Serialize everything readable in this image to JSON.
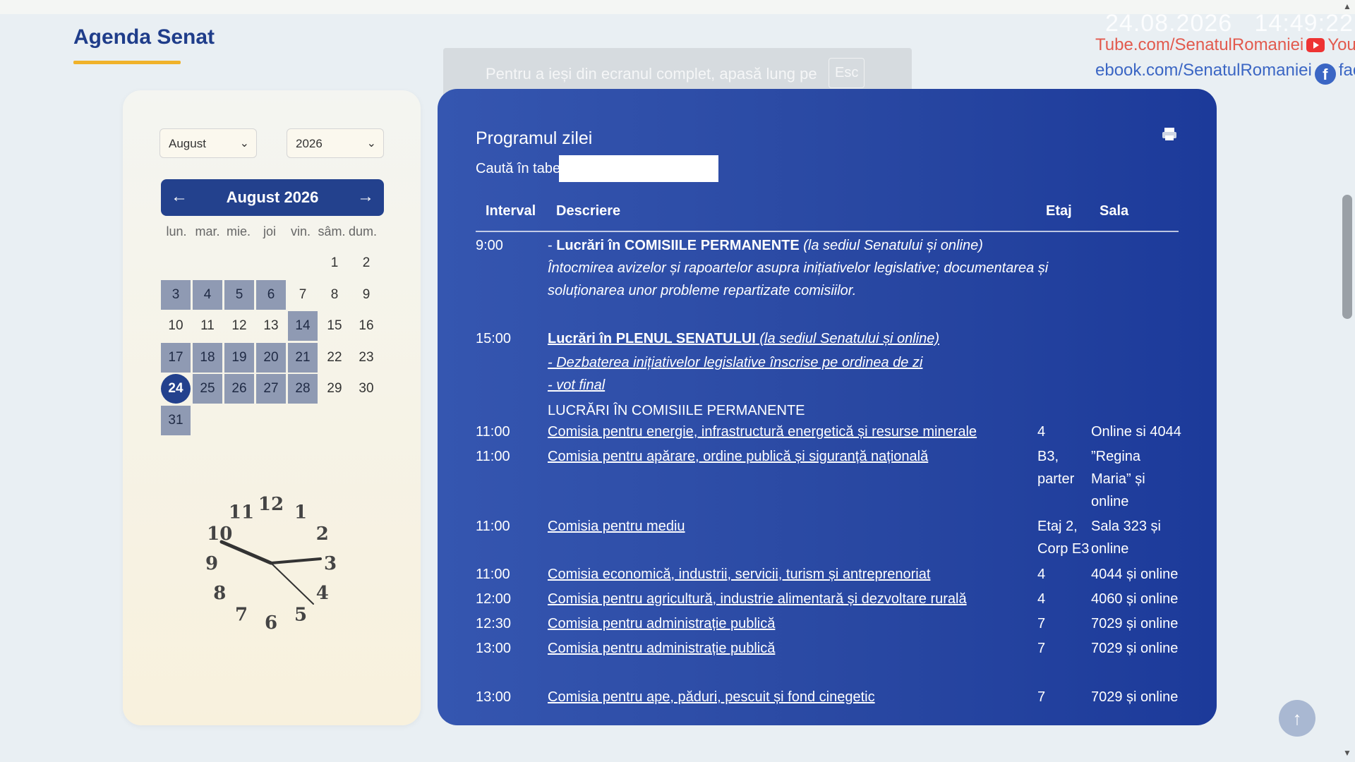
{
  "header": {
    "title": "Agenda Senat"
  },
  "fullscreen_hint": {
    "text": "Pentru a ieși din ecranul complet, apasă lung pe",
    "key": "Esc"
  },
  "overlay": {
    "datetime": "24.08.2026   14:49:22",
    "youtube": "Tube.com/SenatulRomaniei",
    "youtube_after": "You",
    "facebook": "ebook.com/SenatulRomaniei",
    "facebook_after": "face"
  },
  "calendar": {
    "month_select": "August",
    "year_select": "2026",
    "header": "August 2026",
    "prev_icon": "arrow-left",
    "next_icon": "arrow-right",
    "weekdays": [
      "lun.",
      "mar.",
      "mie.",
      "joi",
      "vin.",
      "sâm.",
      "dum."
    ],
    "days": [
      {
        "d": "1",
        "col": 5,
        "row": 0,
        "busy": false
      },
      {
        "d": "2",
        "col": 6,
        "row": 0,
        "busy": false
      },
      {
        "d": "3",
        "col": 0,
        "row": 1,
        "busy": true
      },
      {
        "d": "4",
        "col": 1,
        "row": 1,
        "busy": true
      },
      {
        "d": "5",
        "col": 2,
        "row": 1,
        "busy": true
      },
      {
        "d": "6",
        "col": 3,
        "row": 1,
        "busy": true
      },
      {
        "d": "7",
        "col": 4,
        "row": 1,
        "busy": false
      },
      {
        "d": "8",
        "col": 5,
        "row": 1,
        "busy": false
      },
      {
        "d": "9",
        "col": 6,
        "row": 1,
        "busy": false
      },
      {
        "d": "10",
        "col": 0,
        "row": 2,
        "busy": false
      },
      {
        "d": "11",
        "col": 1,
        "row": 2,
        "busy": false
      },
      {
        "d": "12",
        "col": 2,
        "row": 2,
        "busy": false
      },
      {
        "d": "13",
        "col": 3,
        "row": 2,
        "busy": false
      },
      {
        "d": "14",
        "col": 4,
        "row": 2,
        "busy": true
      },
      {
        "d": "15",
        "col": 5,
        "row": 2,
        "busy": false
      },
      {
        "d": "16",
        "col": 6,
        "row": 2,
        "busy": false
      },
      {
        "d": "17",
        "col": 0,
        "row": 3,
        "busy": true
      },
      {
        "d": "18",
        "col": 1,
        "row": 3,
        "busy": true
      },
      {
        "d": "19",
        "col": 2,
        "row": 3,
        "busy": true
      },
      {
        "d": "20",
        "col": 3,
        "row": 3,
        "busy": true
      },
      {
        "d": "21",
        "col": 4,
        "row": 3,
        "busy": true
      },
      {
        "d": "22",
        "col": 5,
        "row": 3,
        "busy": false
      },
      {
        "d": "23",
        "col": 6,
        "row": 3,
        "busy": false
      },
      {
        "d": "24",
        "col": 0,
        "row": 4,
        "busy": false,
        "today": true
      },
      {
        "d": "25",
        "col": 1,
        "row": 4,
        "busy": true
      },
      {
        "d": "26",
        "col": 2,
        "row": 4,
        "busy": true
      },
      {
        "d": "27",
        "col": 3,
        "row": 4,
        "busy": true
      },
      {
        "d": "28",
        "col": 4,
        "row": 4,
        "busy": true
      },
      {
        "d": "29",
        "col": 5,
        "row": 4,
        "busy": false
      },
      {
        "d": "30",
        "col": 6,
        "row": 4,
        "busy": false
      },
      {
        "d": "31",
        "col": 0,
        "row": 5,
        "busy": true
      }
    ],
    "clock_numbers": [
      "12",
      "1",
      "2",
      "3",
      "4",
      "5",
      "6",
      "7",
      "8",
      "9",
      "10",
      "11"
    ]
  },
  "program": {
    "title": "Programul zilei",
    "search_label": "Caută în tabel",
    "search_value": "",
    "columns": {
      "interval": "Interval",
      "descriere": "Descriere",
      "etaj": "Etaj",
      "sala": "Sala"
    },
    "block1": {
      "time": "9:00",
      "prefix": "- ",
      "bold": "Lucrări în COMISIILE PERMANENTE",
      "italic": " (la sediul Senatului și online)",
      "line2": "Întocmirea avizelor și rapoartelor asupra inițiativelor legislative; documentarea și",
      "line3": "soluționarea unor probleme repartizate comisiilor."
    },
    "block2": {
      "time": "15:00",
      "bold": "Lucrări în PLENUL SENATULUI",
      "italic": "  (la sediul Senatului și online)",
      "line2": "- Dezbaterea inițiativelor legislative înscrise pe ordinea de zi",
      "line3": "- vot final",
      "section": "LUCRĂRI ÎN COMISIILE PERMANENTE"
    },
    "rows": [
      {
        "time": "11:00",
        "desc": "Comisia pentru energie, infrastructură energetică și resurse minerale",
        "etaj": "4",
        "sala": "Online si 4044"
      },
      {
        "time": "11:00",
        "desc": "Comisia pentru apărare, ordine publică și siguranță națională",
        "etaj": "B3, parter",
        "sala": "”Regina Maria” și online"
      },
      {
        "time": "11:00",
        "desc": "Comisia pentru mediu",
        "etaj": "Etaj 2, Corp E3",
        "sala": "Sala 323 și online"
      },
      {
        "time": "11:00",
        "desc": "Comisia economică, industrii, servicii, turism și antreprenoriat",
        "etaj": "4",
        "sala": "4044 și online"
      },
      {
        "time": "12:00",
        "desc": "Comisia pentru agricultură, industrie alimentară și dezvoltare rurală",
        "etaj": "4",
        "sala": "4060 și online"
      },
      {
        "time": "12:30",
        "desc": "Comisia pentru administrație publică",
        "etaj": "7",
        "sala": "7029 și online"
      },
      {
        "time": "13:00",
        "desc": "Comisia pentru administrație publică",
        "etaj": "7",
        "sala": "7029  și online"
      },
      {
        "time": "13:00",
        "desc": "Comisia pentru ape, păduri, pescuit și fond cinegetic",
        "etaj": "7",
        "sala": "7029 și online"
      }
    ]
  },
  "ui": {
    "scroll_top_icon": "arrow-up"
  },
  "colors": {
    "accent": "#23418d",
    "underline": "#f0b22a",
    "busy_day": "#8f9ab3",
    "panel": "#2a49a3"
  }
}
